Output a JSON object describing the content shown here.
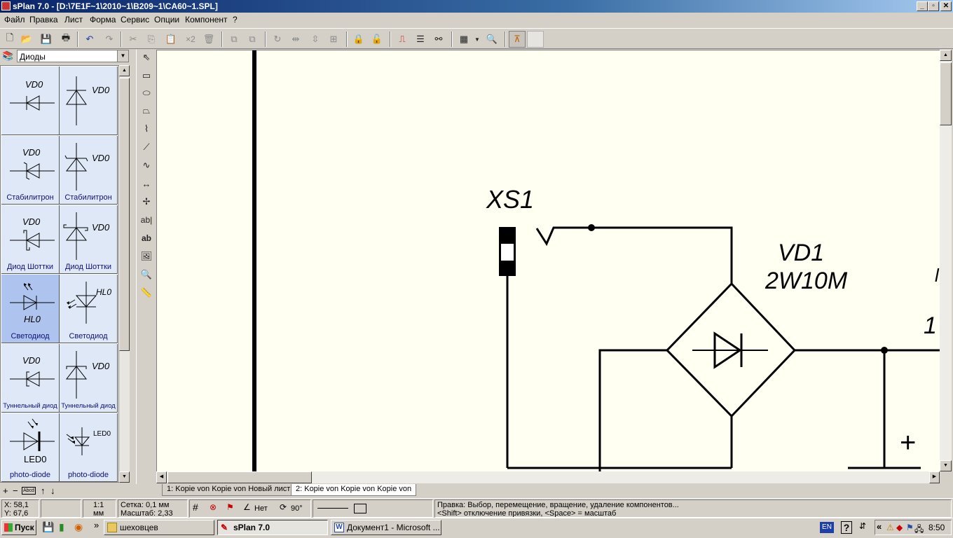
{
  "window": {
    "title": "sPlan 7.0 - [D:\\7E1F~1\\2010~1\\B209~1\\CA60~1.SPL]",
    "controls": {
      "minimize": "_",
      "maximize": "▫",
      "close": "✕"
    }
  },
  "menu": [
    "Файл",
    "Правка",
    "Лист",
    "Форма",
    "Сервис",
    "Опции",
    "Компонент",
    "?"
  ],
  "toolbar": {
    "multiply_label": "×2"
  },
  "library": {
    "selected": "Диоды",
    "components": [
      {
        "label": "",
        "ref": "VD0"
      },
      {
        "label": "",
        "ref": "VD0"
      },
      {
        "label": "Стабилитрон",
        "ref": "VD0"
      },
      {
        "label": "Стабилитрон",
        "ref": "VD0"
      },
      {
        "label": "Диод Шоттки",
        "ref": "VD0"
      },
      {
        "label": "Диод Шоттки",
        "ref": "VD0"
      },
      {
        "label": "Светодиод",
        "ref": "HL0"
      },
      {
        "label": "Светодиод",
        "ref": "HL0"
      },
      {
        "label": "Туннельный диод",
        "ref": "VD0"
      },
      {
        "label": "Туннельный диод",
        "ref": "VD0"
      },
      {
        "label": "photo-diode",
        "ref": "LED0"
      },
      {
        "label": "photo-diode",
        "ref": "LED0"
      }
    ],
    "bottom_controls": [
      "+",
      "−",
      "Abcd",
      "↑",
      "↓"
    ]
  },
  "schematic": {
    "connector_label": "XS1",
    "bridge_ref": "VD1",
    "bridge_part": "2W10M",
    "partial_ref": "1",
    "partial_edge": "l",
    "plus_sign": "+"
  },
  "tabs": [
    {
      "label": "1: Kopie von Kopie von Новый лист",
      "active": false
    },
    {
      "label": "2: Kopie von Kopie von Kopie von",
      "active": true
    }
  ],
  "status": {
    "x": "X: 58,1",
    "y": "Y: 67,6",
    "scale_ratio": "1:1",
    "scale_unit": "мм",
    "grid": "Сетка: 0,1 мм",
    "zoom": "Масштаб:  2,33",
    "angle_mode": "Нет",
    "rotation": "90°",
    "hint_line1": "Правка: Выбор, перемещение, вращение, удаление компонентов...",
    "hint_line2": "<Shift> отключение привязки, <Space> = масштаб"
  },
  "taskbar": {
    "start": "Пуск",
    "tasks": [
      {
        "label": "шеховцев",
        "active": false
      },
      {
        "label": "sPlan 7.0",
        "active": true
      },
      {
        "label": "Документ1 - Microsoft ...",
        "active": false
      }
    ],
    "lang": "EN",
    "time": "8:50",
    "chevron": "»",
    "tray_chevron": "«"
  },
  "colors": {
    "canvas_bg": "#fffff2",
    "wire": "#000000",
    "cell_bg": "#dfe8f7",
    "cell_selected": "#aec4ee",
    "cell_text": "#10107a",
    "title_start": "#0a246a"
  }
}
